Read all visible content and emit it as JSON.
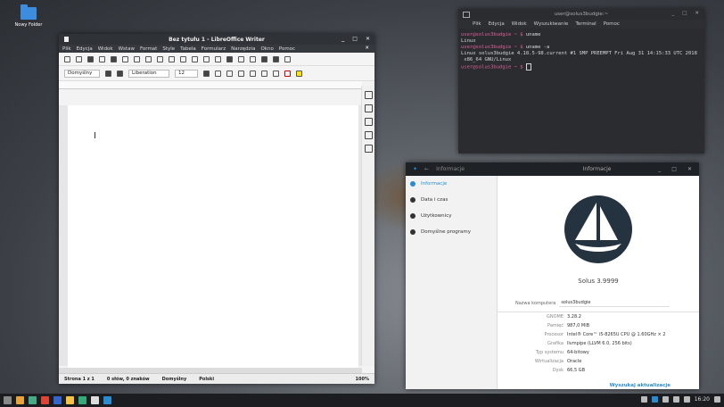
{
  "desktop": {
    "folder_label": "Nowy Folder"
  },
  "writer": {
    "title": "Bez tytułu 1 - LibreOffice Writer",
    "menu": [
      "Plik",
      "Edycja",
      "Widok",
      "Wstaw",
      "Format",
      "Style",
      "Tabela",
      "Formularz",
      "Narzędzia",
      "Okno",
      "Pomoc"
    ],
    "para_style": "Domyślny",
    "font": "Liberation",
    "size": "12",
    "status": {
      "page": "Strona 1 z 1",
      "words": "0 słów, 0 znaków",
      "style": "Domyślny",
      "lang": "Polski",
      "zoom": "100%"
    }
  },
  "terminal": {
    "title": "user@solus3budgie:~",
    "menu": [
      "Plik",
      "Edycja",
      "Widok",
      "Wyszukiwanie",
      "Terminal",
      "Pomoc"
    ],
    "lines": [
      {
        "prompt": "user@solus3budgie ~ $",
        "text": " uname"
      },
      {
        "prompt": "",
        "text": "Linux"
      },
      {
        "prompt": "user@solus3budgie ~ $",
        "text": " uname -a"
      },
      {
        "prompt": "",
        "text": "Linux solus3budgie 4.18.5-98.current #1 SMP PREEMPT Fri Aug 31 14:15:33 UTC 2018"
      },
      {
        "prompt": "",
        "text": " x86_64 GNU/Linux"
      },
      {
        "prompt": "user@solus3budgie ~ $",
        "text": " "
      }
    ]
  },
  "info": {
    "header_left": "Informacje",
    "title": "Informacje",
    "nav": [
      {
        "label": "Informacje",
        "icon": "info-icon",
        "active": true
      },
      {
        "label": "Data i czas",
        "icon": "clock-icon",
        "active": false
      },
      {
        "label": "Użytkownicy",
        "icon": "users-icon",
        "active": false
      },
      {
        "label": "Domyślne programy",
        "icon": "star-icon",
        "active": false
      }
    ],
    "version": "Solus 3.9999",
    "host_label": "Nazwa komputera",
    "host": "solus3budgie",
    "specs": [
      {
        "k": "GNOME",
        "v": "3.28.2"
      },
      {
        "k": "Pamięć",
        "v": "987,0 MiB"
      },
      {
        "k": "Procesor",
        "v": "Intel® Core™ i5-8265U CPU @ 1.60GHz × 2"
      },
      {
        "k": "Grafika",
        "v": "llvmpipe (LLVM 6.0, 256 bits)"
      },
      {
        "k": "Typ systemu",
        "v": "64-bitowy"
      },
      {
        "k": "Wirtualizacja",
        "v": "Oracle"
      },
      {
        "k": "Dysk",
        "v": "66,5 GB"
      }
    ],
    "update_btn": "Wyszukaj aktualizacje"
  },
  "panel": {
    "clock": "16:20",
    "accent": "#2a8cd0"
  }
}
